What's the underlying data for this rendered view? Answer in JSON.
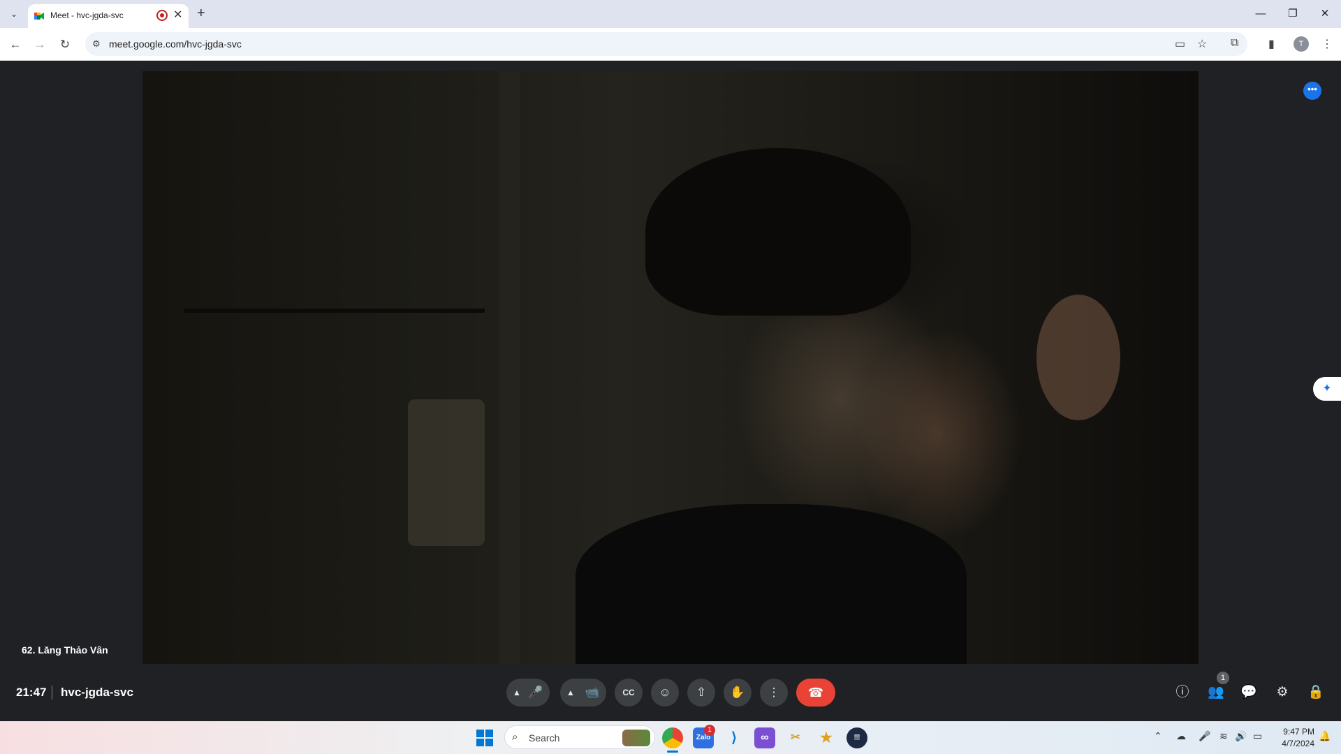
{
  "browser": {
    "tab_title": "Meet - hvc-jgda-svc",
    "tab_close": "✕",
    "new_tab": "+",
    "url": "meet.google.com/hvc-jgda-svc",
    "profile_initial": "T",
    "window_controls": {
      "minimize": "—",
      "restore": "❐",
      "close": "✕"
    }
  },
  "meet": {
    "participant_name": "62. Lăng Thảo Vân",
    "meeting_time": "21:47",
    "meeting_code": "hvc-jgda-svc",
    "people_count": "1",
    "controls": {
      "mic_label": "🎤",
      "camera_label": "📹",
      "captions_label": "CC",
      "emoji_label": "☺",
      "present_label": "⇧",
      "hand_label": "✋",
      "more_label": "⋮",
      "end_call_label": "☎"
    },
    "right_controls": {
      "info_label": "ⓘ",
      "people_label": "👥",
      "chat_label": "💬",
      "activities_label": "⚙",
      "host_label": "🔒"
    },
    "accent_color": "#1a73e8",
    "end_call_color": "#ea4335"
  },
  "taskbar": {
    "search_placeholder": "Search",
    "notification_count": "1",
    "time": "9:47 PM",
    "date": "4/7/2024"
  }
}
